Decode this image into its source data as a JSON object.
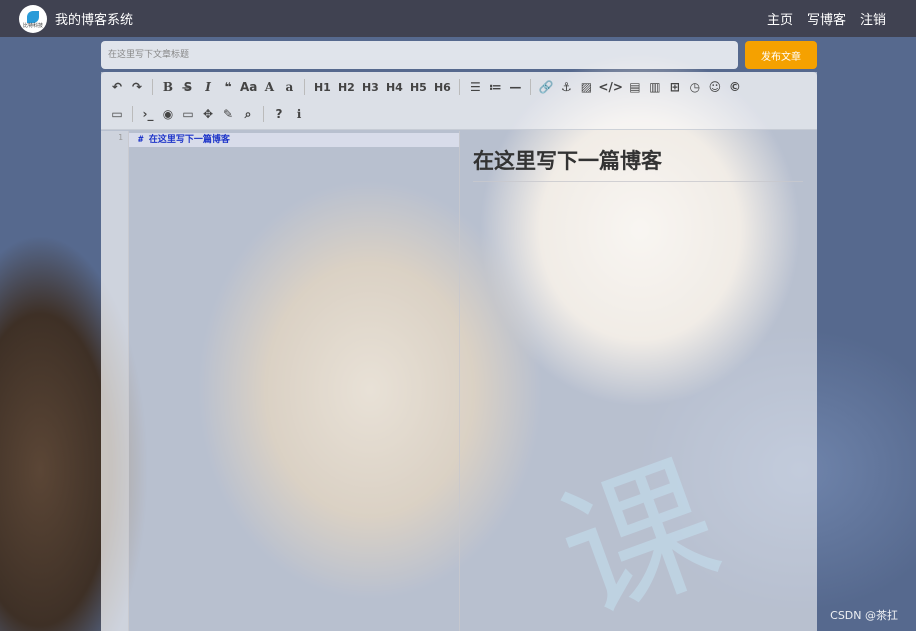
{
  "header": {
    "logo_label": "比特科技",
    "site_title": "我的博客系统",
    "nav": [
      "主页",
      "写博客",
      "注销"
    ]
  },
  "title_input": {
    "placeholder": "在这里写下文章标题",
    "value": ""
  },
  "publish_button": "发布文章",
  "toolbar": {
    "row1": [
      {
        "name": "undo-icon",
        "glyph": "↶"
      },
      {
        "name": "redo-icon",
        "glyph": "↷"
      },
      {
        "sep": true
      },
      {
        "name": "bold-icon",
        "glyph": "B"
      },
      {
        "name": "strikethrough-icon",
        "glyph": "S̶"
      },
      {
        "name": "italic-icon",
        "glyph": "I"
      },
      {
        "name": "quote-icon",
        "glyph": "❝"
      },
      {
        "name": "uppercase-icon",
        "glyph": "Aa"
      },
      {
        "name": "capitalize-icon",
        "glyph": "A"
      },
      {
        "name": "lowercase-icon",
        "glyph": "a"
      },
      {
        "sep": true
      },
      {
        "name": "h1-button",
        "glyph": "H1"
      },
      {
        "name": "h2-button",
        "glyph": "H2"
      },
      {
        "name": "h3-button",
        "glyph": "H3"
      },
      {
        "name": "h4-button",
        "glyph": "H4"
      },
      {
        "name": "h5-button",
        "glyph": "H5"
      },
      {
        "name": "h6-button",
        "glyph": "H6"
      },
      {
        "sep": true
      },
      {
        "name": "unordered-list-icon",
        "glyph": "☰"
      },
      {
        "name": "ordered-list-icon",
        "glyph": "≔"
      },
      {
        "name": "horizontal-rule-icon",
        "glyph": "—"
      },
      {
        "sep": true
      },
      {
        "name": "link-icon",
        "glyph": "🔗"
      },
      {
        "name": "anchor-icon",
        "glyph": "⚓"
      },
      {
        "name": "image-icon",
        "glyph": "▨"
      },
      {
        "name": "code-icon",
        "glyph": "</>"
      },
      {
        "name": "code-block-icon",
        "glyph": "▤"
      },
      {
        "name": "preformatted-icon",
        "glyph": "▥"
      },
      {
        "name": "table-icon",
        "glyph": "⊞"
      },
      {
        "name": "datetime-icon",
        "glyph": "◷"
      },
      {
        "name": "emoji-icon",
        "glyph": "☺"
      },
      {
        "name": "html-entities-icon",
        "glyph": "©"
      }
    ],
    "row2": [
      {
        "name": "pagebreak-icon",
        "glyph": "▭"
      },
      {
        "sep": true
      },
      {
        "name": "goto-line-icon",
        "glyph": "›_"
      },
      {
        "name": "watch-icon",
        "glyph": "◉"
      },
      {
        "name": "preview-icon",
        "glyph": "▭"
      },
      {
        "name": "fullscreen-icon",
        "glyph": "✥"
      },
      {
        "name": "clear-icon",
        "glyph": "✎"
      },
      {
        "name": "search-icon",
        "glyph": "⌕"
      },
      {
        "sep": true
      },
      {
        "name": "help-icon",
        "glyph": "?"
      },
      {
        "name": "info-icon",
        "glyph": "ℹ"
      }
    ]
  },
  "editor": {
    "line_number": "1",
    "code_line": "# 在这里写下一篇博客",
    "preview_heading": "在这里写下一篇博客"
  },
  "watermark": "CSDN @茶扛",
  "decoration_char": "课"
}
